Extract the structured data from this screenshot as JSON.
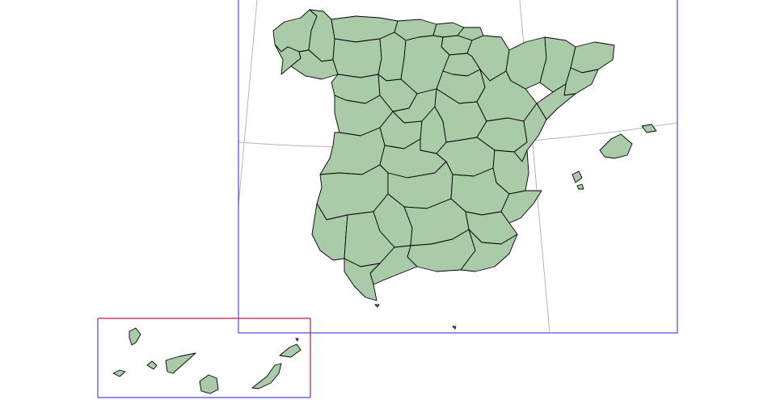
{
  "map": {
    "subject": "provinces-of-spain",
    "colors": {
      "land": "#a9cba8",
      "border": "#000000",
      "graticule": "#b5b5b5",
      "mainland_frame": "#4a4ae8",
      "canary_frame_top": "#c0203c",
      "canary_frame_sides": "#4a4ae8",
      "background": "#ffffff"
    },
    "insets": [
      "mainland-and-balearics",
      "canary-islands"
    ],
    "graticule": "on",
    "labels": "none"
  }
}
